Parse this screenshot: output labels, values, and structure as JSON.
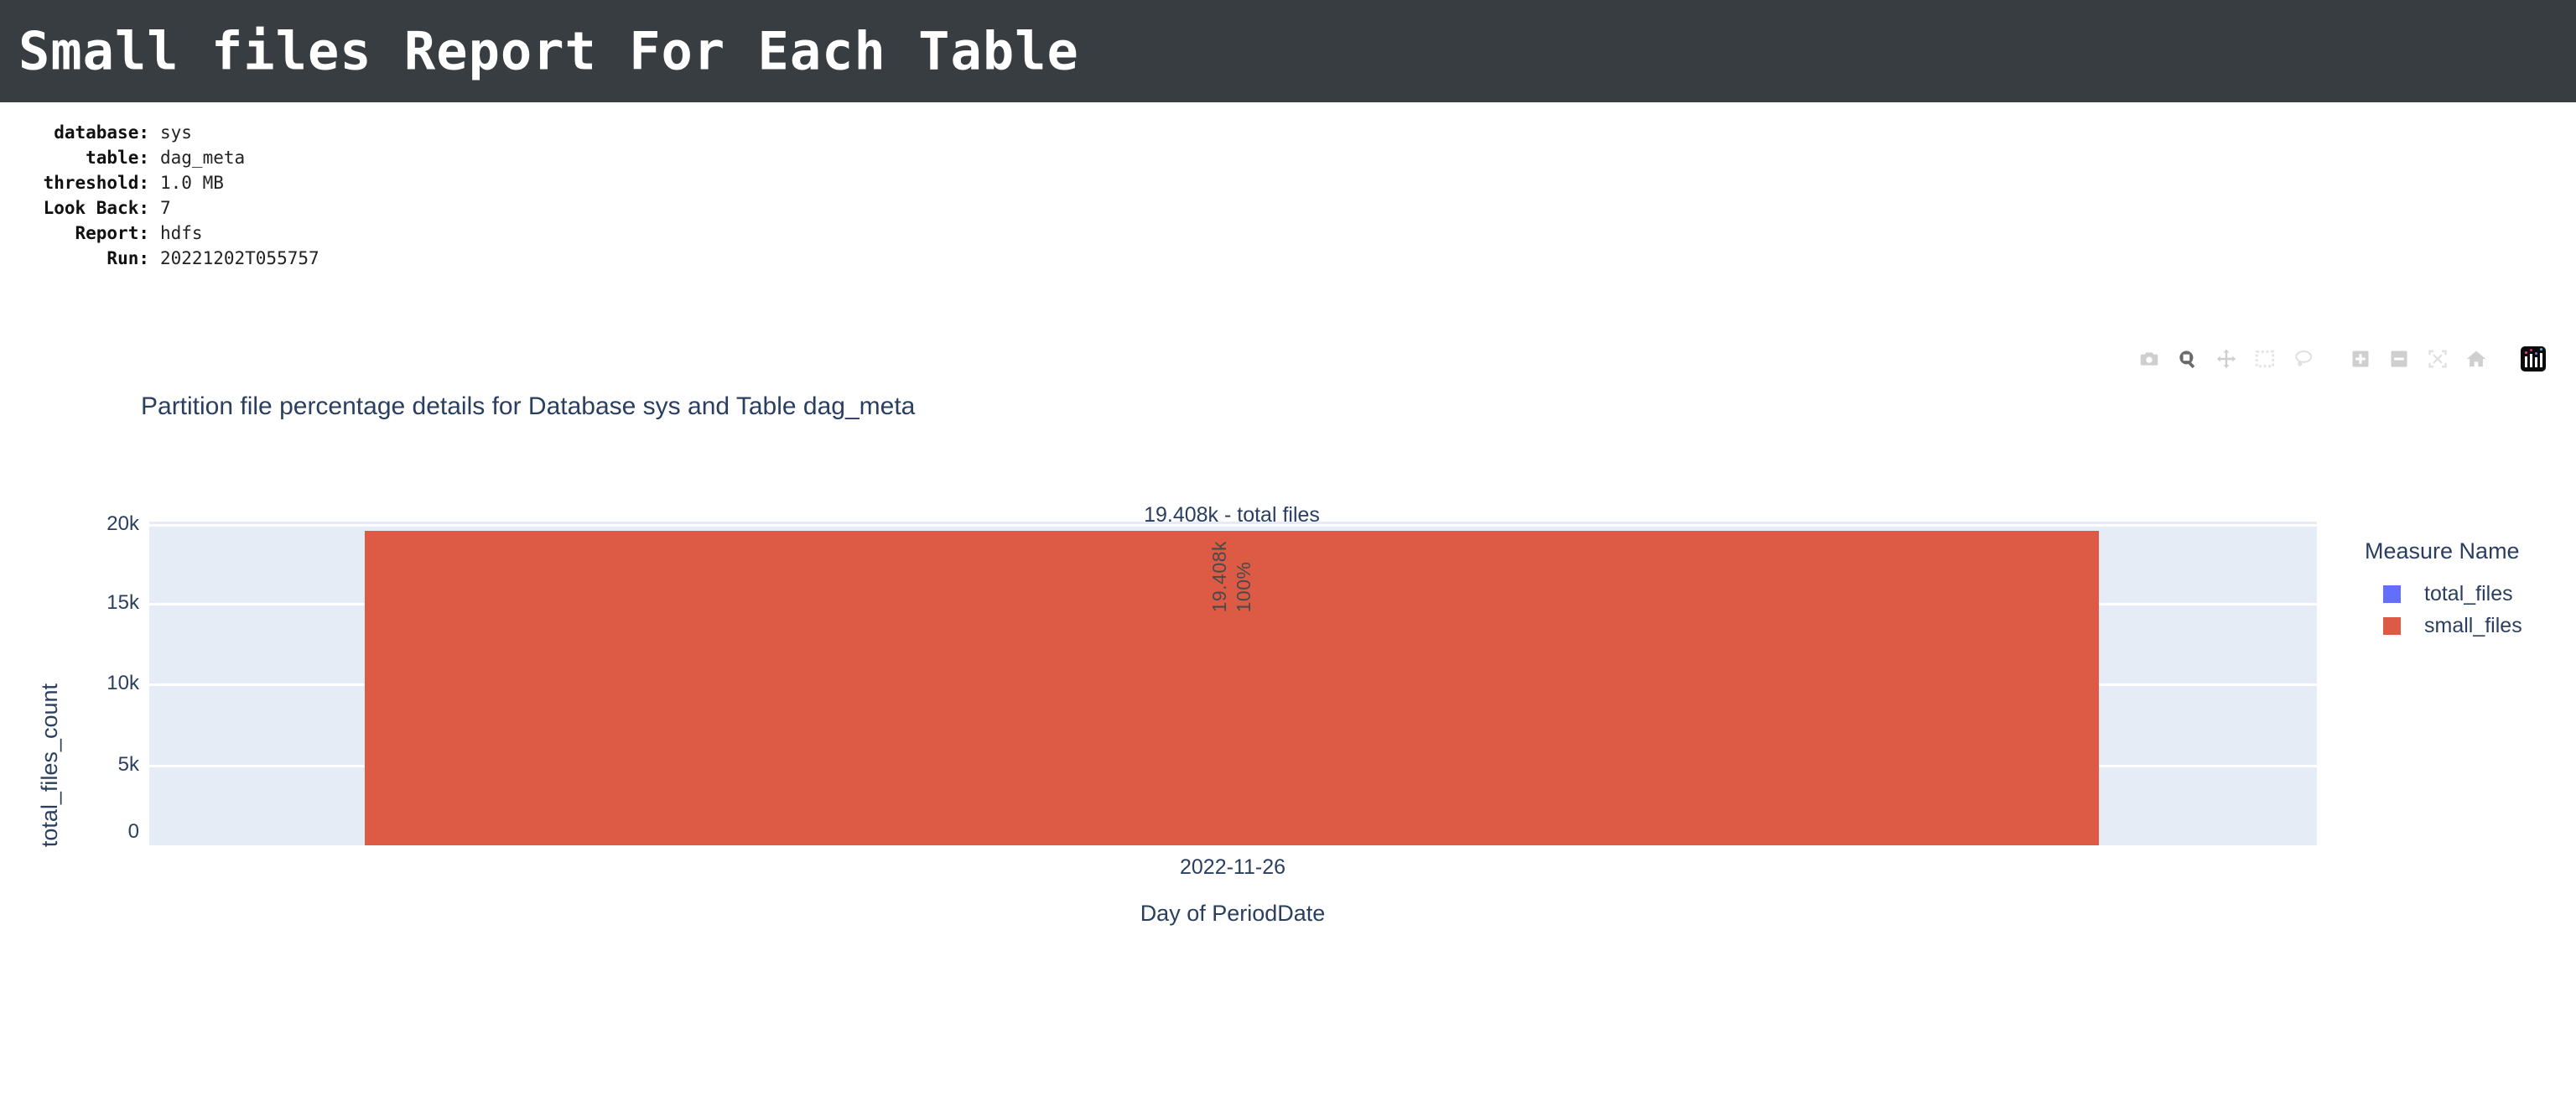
{
  "header": {
    "title": "Small files Report For Each Table"
  },
  "meta": {
    "rows": [
      {
        "label": "database:",
        "value": "sys"
      },
      {
        "label": "table:",
        "value": "dag_meta"
      },
      {
        "label": "threshold:",
        "value": "1.0 MB"
      },
      {
        "label": "Look Back:",
        "value": "7"
      },
      {
        "label": "Report:",
        "value": "hdfs"
      },
      {
        "label": "Run:",
        "value": "20221202T055757"
      }
    ]
  },
  "modebar": {
    "buttons": [
      {
        "name": "download-camera-icon",
        "title": "Download plot as a png",
        "active": false
      },
      {
        "name": "zoom-icon",
        "title": "Zoom",
        "active": true
      },
      {
        "name": "pan-icon",
        "title": "Pan",
        "active": false
      },
      {
        "name": "box-select-icon",
        "title": "Box Select",
        "active": false
      },
      {
        "name": "lasso-select-icon",
        "title": "Lasso Select",
        "active": false
      },
      {
        "name": "zoom-in-icon",
        "title": "Zoom in",
        "active": false
      },
      {
        "name": "zoom-out-icon",
        "title": "Zoom out",
        "active": false
      },
      {
        "name": "autoscale-icon",
        "title": "Autoscale",
        "active": false
      },
      {
        "name": "reset-axes-home-icon",
        "title": "Reset axes",
        "active": false
      },
      {
        "name": "plotly-logo-icon",
        "title": "Produced with Plotly",
        "active": false
      }
    ]
  },
  "chart_data": {
    "type": "bar",
    "title": "Partition file percentage details for Database sys and Table dag_meta",
    "xlabel": "Day of PeriodDate",
    "ylabel": "total_files_count",
    "categories": [
      "2022-11-26"
    ],
    "ytick_labels": [
      "0",
      "5k",
      "10k",
      "15k",
      "20k"
    ],
    "ytick_values": [
      0,
      5000,
      10000,
      15000,
      20000
    ],
    "ylim": [
      0,
      20000
    ],
    "grid": true,
    "legend_position": "right",
    "legend_title": "Measure Name",
    "series": [
      {
        "name": "total_files",
        "color": "#636efa",
        "values": [
          19408
        ]
      },
      {
        "name": "small_files",
        "color": "#dd5b45",
        "values": [
          19408
        ]
      }
    ],
    "annotations": [
      {
        "name": "bar-total-annotation",
        "text": "19.408k - total files",
        "x": "2022-11-26",
        "y": 19408
      },
      {
        "name": "bar-value-label",
        "text": "19.408k",
        "rotated": true
      },
      {
        "name": "bar-percent-label",
        "text": "100%",
        "rotated": true
      }
    ],
    "bar_value_display": "19.408k",
    "bar_percent_display": "100%",
    "colors": {
      "plot_background": "#e5ecf6",
      "gridline": "#ffffff",
      "text": "#2a3f5f",
      "bar": "#dd5b45",
      "header_background": "#373d41"
    }
  }
}
